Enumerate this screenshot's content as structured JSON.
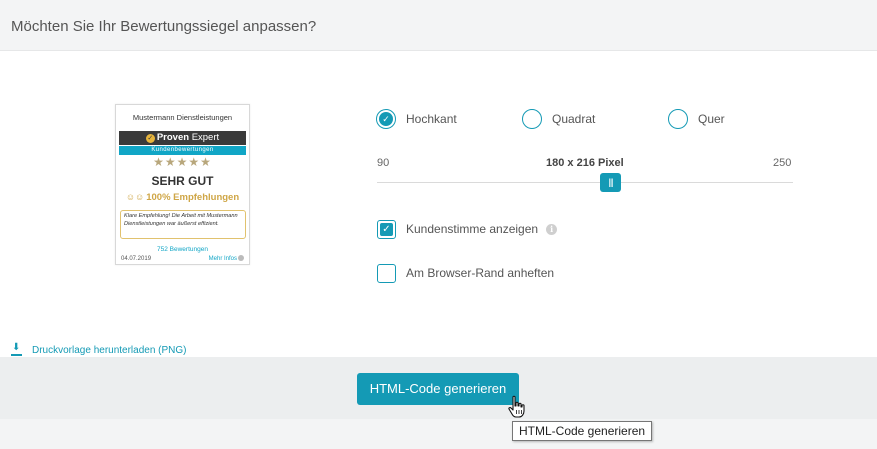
{
  "header": {
    "title": "Möchten Sie Ihr Bewertungssiegel anpassen?"
  },
  "seal": {
    "company": "Mustermann Dienstleistungen",
    "brand_bold": "Proven",
    "brand_light": "Expert",
    "subtitle": "Kundenbewertungen",
    "stars": "★★★★★",
    "rating": 4.5,
    "grade": "SEHR GUT",
    "recommend": "100% Empfehlungen",
    "quote": "Klare Empfehlung! Die Arbeit mit Mustermann Dienstleistungen war äußerst effizient.",
    "count": "752 Bewertungen",
    "date": "04.07.2019",
    "more": "Mehr Infos",
    "colors": {
      "dark": "#3a3a3a",
      "accent": "#11a6c6",
      "gold": "#cfa646"
    }
  },
  "orientation": {
    "options": [
      {
        "label": "Hochkant",
        "checked": true
      },
      {
        "label": "Quadrat",
        "checked": false
      },
      {
        "label": "Quer",
        "checked": false
      }
    ]
  },
  "slider": {
    "min": "90",
    "max": "250",
    "value_label": "180 x 216 Pixel",
    "value": 180,
    "handle_glyph": "|||"
  },
  "options": {
    "show_voice": {
      "label": "Kundenstimme anzeigen",
      "checked": true,
      "info": "i"
    },
    "attach_edge": {
      "label": "Am Browser-Rand anheften",
      "checked": false
    }
  },
  "download": {
    "label": "Druckvorlage herunterladen (PNG)"
  },
  "footer": {
    "button_label": "HTML-Code generieren",
    "tooltip": "HTML-Code generieren"
  },
  "theme": {
    "accent": "#149ab5"
  }
}
